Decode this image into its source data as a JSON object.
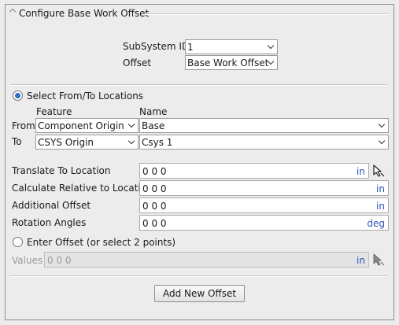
{
  "panel": {
    "title": "Configure Base Work Offset"
  },
  "subsystem": {
    "label": "SubSystem ID",
    "value": "1",
    "offset_label": "Offset",
    "offset_value": "Base Work Offset"
  },
  "locations": {
    "radio_label": "Select From/To Locations",
    "selected": true,
    "feature_header": "Feature",
    "name_header": "Name",
    "from_label": "From",
    "from_feature": "Component Origin",
    "from_name": "Base",
    "to_label": "To",
    "to_feature": "CSYS Origin",
    "to_name": "Csys 1"
  },
  "fields": {
    "translate_label": "Translate To Location",
    "translate_value": "0 0 0",
    "translate_unit": "in",
    "relative_label": "Calculate Relative to Location",
    "relative_value": "0 0 0",
    "relative_unit": "in",
    "additional_label": "Additional Offset",
    "additional_value": "0 0 0",
    "additional_unit": "in",
    "rotation_label": "Rotation Angles",
    "rotation_value": "0 0 0",
    "rotation_unit": "deg"
  },
  "enter_offset": {
    "radio_label": "Enter Offset (or select 2 points)",
    "selected": false,
    "values_label": "Values",
    "values_value": "0 0 0",
    "values_unit": "in"
  },
  "actions": {
    "add_label": "Add New Offset"
  },
  "icons": {
    "collapse": "chevron-up-icon",
    "pick": "cursor-select-icon"
  }
}
